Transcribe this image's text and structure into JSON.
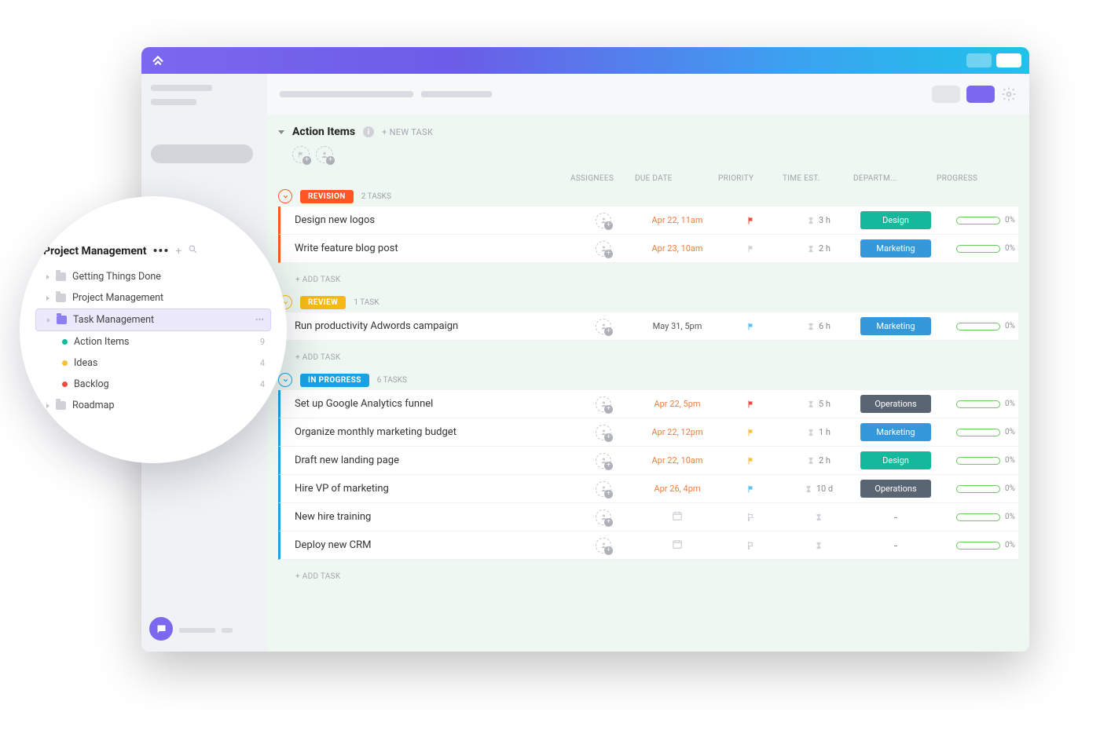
{
  "list": {
    "title": "Action Items",
    "new_task": "+ NEW TASK",
    "add_task": "+ ADD TASK"
  },
  "columns": {
    "assignees": "ASSIGNEES",
    "due": "DUE DATE",
    "priority": "PRIORITY",
    "est": "TIME EST.",
    "dept": "DEPARTM...",
    "progress": "PROGRESS"
  },
  "dept_colors": {
    "Design": "#14b89b",
    "Marketing": "#3498db",
    "Operations": "#5a6573"
  },
  "flag_colors": {
    "red": "#f0473e",
    "gray": "#cfd1d7",
    "blue": "#57c0f5",
    "yellow": "#f5c23d",
    "none": "#cfd1d7"
  },
  "groups": [
    {
      "name": "REVISION",
      "color": "#ff5722",
      "count_label": "2 TASKS",
      "tasks": [
        {
          "name": "Design new logos",
          "due": "Apr 22, 11am",
          "due_style": "orange",
          "flag": "red",
          "est": "3 h",
          "dept": "Design",
          "progress": "0%"
        },
        {
          "name": "Write feature blog post",
          "due": "Apr 23, 10am",
          "due_style": "orange",
          "flag": "gray",
          "est": "2 h",
          "dept": "Marketing",
          "progress": "0%"
        }
      ]
    },
    {
      "name": "REVIEW",
      "color": "#f5b916",
      "count_label": "1 TASK",
      "tasks": [
        {
          "name": "Run productivity Adwords campaign",
          "due": "May 31, 5pm",
          "due_style": "gray",
          "flag": "blue",
          "est": "6 h",
          "dept": "Marketing",
          "progress": "0%"
        }
      ]
    },
    {
      "name": "IN PROGRESS",
      "color": "#17a3e0",
      "count_label": "6 TASKS",
      "tasks": [
        {
          "name": "Set up Google Analytics funnel",
          "due": "Apr 22, 5pm",
          "due_style": "orange",
          "flag": "red",
          "est": "5 h",
          "dept": "Operations",
          "progress": "0%"
        },
        {
          "name": "Organize monthly marketing budget",
          "due": "Apr 22, 12pm",
          "due_style": "orange",
          "flag": "yellow",
          "est": "1 h",
          "dept": "Marketing",
          "progress": "0%"
        },
        {
          "name": "Draft new landing page",
          "due": "Apr 22, 10am",
          "due_style": "orange",
          "flag": "yellow",
          "est": "2 h",
          "dept": "Design",
          "progress": "0%"
        },
        {
          "name": "Hire VP of marketing",
          "due": "Apr 26, 4pm",
          "due_style": "orange",
          "flag": "blue",
          "est": "10 d",
          "dept": "Operations",
          "progress": "0%"
        },
        {
          "name": "New hire training",
          "due": "",
          "due_style": "none",
          "flag": "none",
          "est": "",
          "dept": "-",
          "progress": "0%"
        },
        {
          "name": "Deploy new CRM",
          "due": "",
          "due_style": "none",
          "flag": "none",
          "est": "",
          "dept": "-",
          "progress": "0%"
        }
      ]
    }
  ],
  "popout": {
    "title": "Project Management",
    "folders": [
      {
        "label": "Getting Things Done",
        "type": "folder"
      },
      {
        "label": "Project Management",
        "type": "folder"
      },
      {
        "label": "Task Management",
        "type": "folder",
        "selected": true,
        "count": "..."
      },
      {
        "label": "Action Items",
        "type": "sub",
        "dot": "#14b89b",
        "count": "9"
      },
      {
        "label": "Ideas",
        "type": "sub",
        "dot": "#f5c23d",
        "count": "4"
      },
      {
        "label": "Backlog",
        "type": "sub",
        "dot": "#f0473e",
        "count": "4"
      },
      {
        "label": "Roadmap",
        "type": "folder"
      }
    ]
  }
}
